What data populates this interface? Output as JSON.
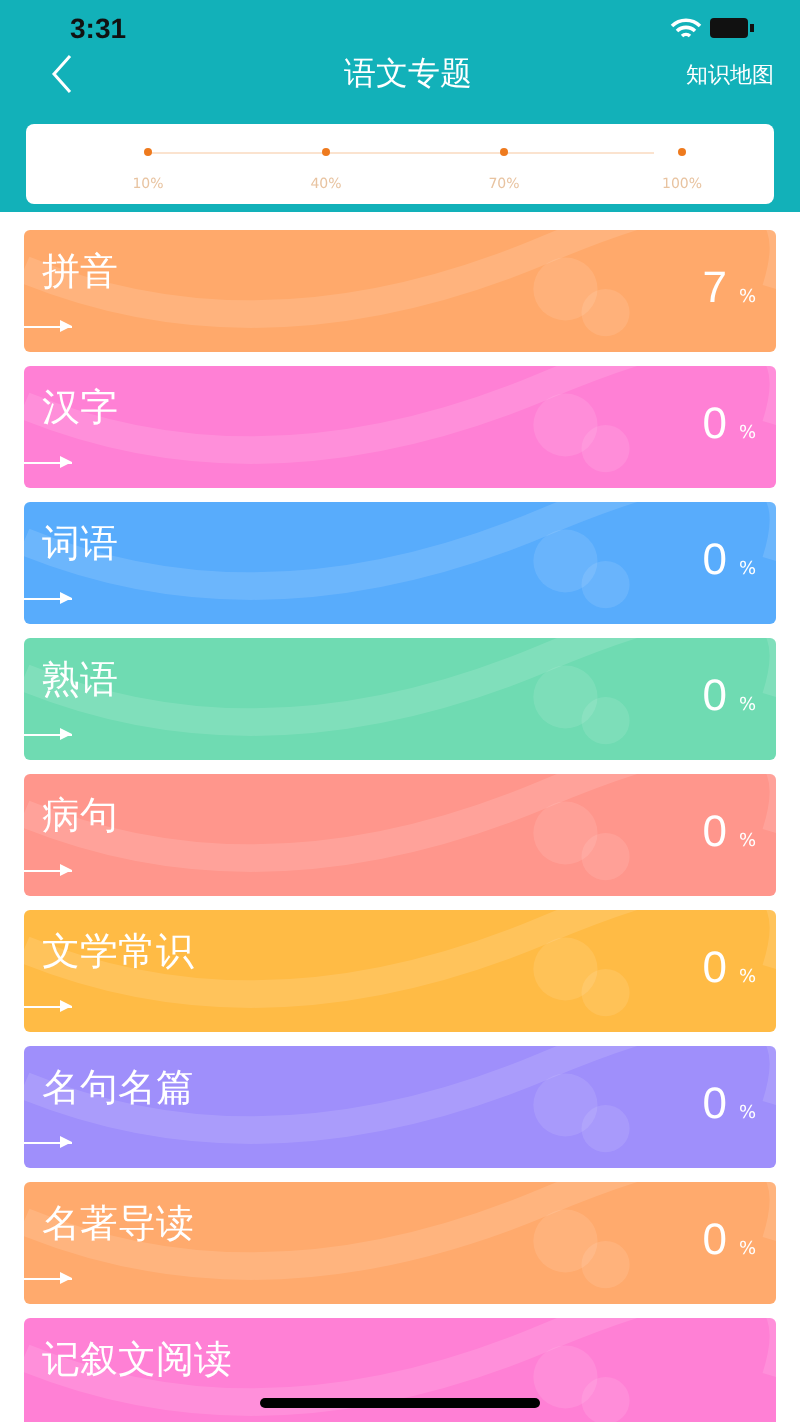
{
  "status_bar": {
    "time": "3:31"
  },
  "nav": {
    "title": "语文专题",
    "action": "知识地图"
  },
  "milestones": [
    {
      "label": "10%"
    },
    {
      "label": "40%"
    },
    {
      "label": "70%"
    },
    {
      "label": "100%"
    }
  ],
  "topics": [
    {
      "name": "拼音",
      "percent": "7",
      "unit": "%",
      "color": "#ffa96b"
    },
    {
      "name": "汉字",
      "percent": "0",
      "unit": "%",
      "color": "#ff80d5"
    },
    {
      "name": "词语",
      "percent": "0",
      "unit": "%",
      "color": "#58acfc"
    },
    {
      "name": "熟语",
      "percent": "0",
      "unit": "%",
      "color": "#6fdbb2"
    },
    {
      "name": "病句",
      "percent": "0",
      "unit": "%",
      "color": "#ff968c"
    },
    {
      "name": "文学常识",
      "percent": "0",
      "unit": "%",
      "color": "#ffbb45"
    },
    {
      "name": "名句名篇",
      "percent": "0",
      "unit": "%",
      "color": "#9f8ffb"
    },
    {
      "name": "名著导读",
      "percent": "0",
      "unit": "%",
      "color": "#ffaa6d"
    },
    {
      "name": "记叙文阅读",
      "color": "#ff80d5"
    }
  ]
}
